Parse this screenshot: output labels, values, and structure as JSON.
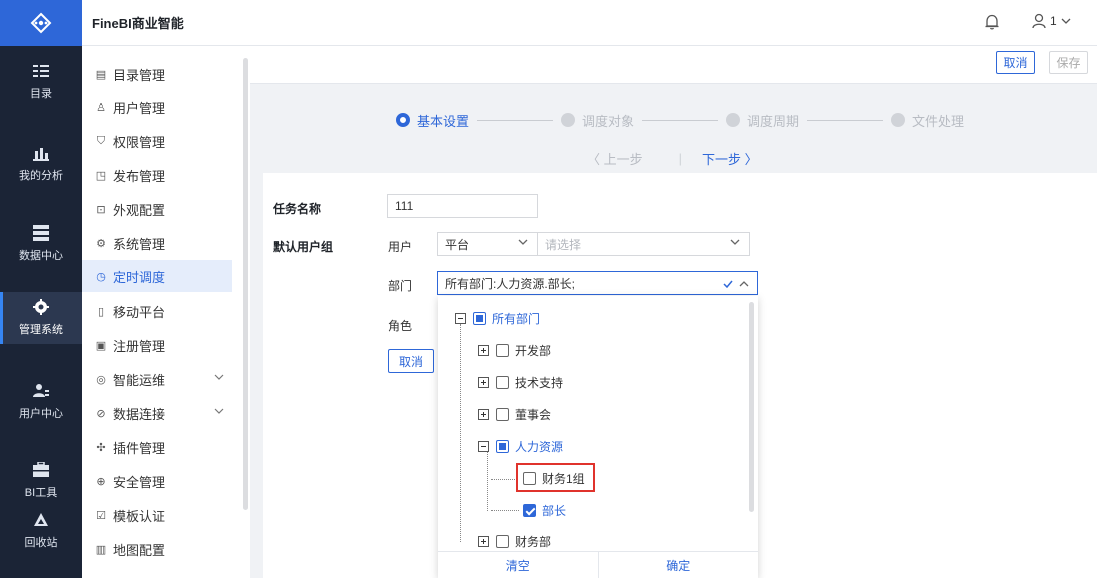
{
  "app": {
    "title": "FineBI商业智能",
    "user": "1"
  },
  "rail": [
    {
      "label": "目录",
      "icon": "catalog-icon"
    },
    {
      "label": "我的分析",
      "icon": "analysis-icon"
    },
    {
      "label": "数据中心",
      "icon": "database-icon"
    },
    {
      "label": "管理系统",
      "icon": "gear-icon",
      "active": true
    },
    {
      "label": "用户中心",
      "icon": "users-icon"
    },
    {
      "label": "BI工具",
      "icon": "toolbox-icon"
    },
    {
      "label": "回收站",
      "icon": "recycle-icon"
    }
  ],
  "menu": [
    {
      "label": "目录管理",
      "icon": "list-icon"
    },
    {
      "label": "用户管理",
      "icon": "user-icon"
    },
    {
      "label": "权限管理",
      "icon": "shield-icon"
    },
    {
      "label": "发布管理",
      "icon": "publish-icon"
    },
    {
      "label": "外观配置",
      "icon": "appearance-icon"
    },
    {
      "label": "系统管理",
      "icon": "settings-icon"
    },
    {
      "label": "定时调度",
      "icon": "clock-icon",
      "active": true
    },
    {
      "label": "移动平台",
      "icon": "mobile-icon"
    },
    {
      "label": "注册管理",
      "icon": "register-icon"
    },
    {
      "label": "智能运维",
      "icon": "ops-icon",
      "expandable": true
    },
    {
      "label": "数据连接",
      "icon": "link-icon",
      "expandable": true
    },
    {
      "label": "插件管理",
      "icon": "plugin-icon"
    },
    {
      "label": "安全管理",
      "icon": "security-icon"
    },
    {
      "label": "模板认证",
      "icon": "certificate-icon"
    },
    {
      "label": "地图配置",
      "icon": "map-icon"
    }
  ],
  "toolbar": {
    "cancel": "取消",
    "save": "保存"
  },
  "steps": {
    "items": [
      "基本设置",
      "调度对象",
      "调度周期",
      "文件处理"
    ],
    "active": 0,
    "prev": "〈 上一步",
    "sep": "|",
    "next": "下一步 〉"
  },
  "form": {
    "task_name_label": "任务名称",
    "task_name_value": "111",
    "default_group_label": "默认用户组",
    "user_label": "用户",
    "user_type": "平台",
    "user_placeholder": "请选择",
    "dept_label": "部门",
    "dept_value": "所有部门:人力资源.部长;",
    "role_label": "角色",
    "cancel": "取消"
  },
  "tree": {
    "root": "所有部门",
    "nodes": [
      "开发部",
      "技术支持",
      "董事会",
      "人力资源",
      "财务部"
    ],
    "hr_children": [
      "财务1组",
      "部长"
    ]
  },
  "dropdown": {
    "clear": "清空",
    "confirm": "确定"
  }
}
